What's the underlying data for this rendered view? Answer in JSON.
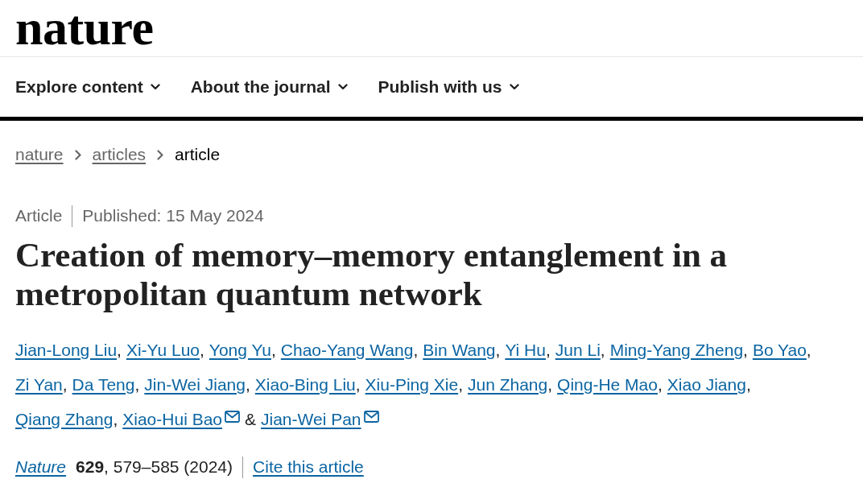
{
  "header": {
    "logo": "nature"
  },
  "nav": [
    {
      "label": "Explore content"
    },
    {
      "label": "About the journal"
    },
    {
      "label": "Publish with us"
    }
  ],
  "breadcrumb": [
    {
      "label": "nature",
      "current": false
    },
    {
      "label": "articles",
      "current": false
    },
    {
      "label": "article",
      "current": true
    }
  ],
  "article": {
    "type": "Article",
    "published": "Published: 15 May 2024",
    "title": "Creation of memory–memory entanglement in a metropolitan quantum network",
    "authors": [
      {
        "name": "Jian-Long Liu",
        "separator": ",",
        "contact": false
      },
      {
        "name": "Xi-Yu Luo",
        "separator": ",",
        "contact": false
      },
      {
        "name": "Yong Yu",
        "separator": ",",
        "contact": false
      },
      {
        "name": "Chao-Yang Wang",
        "separator": ",",
        "contact": false
      },
      {
        "name": "Bin Wang",
        "separator": ",",
        "contact": false
      },
      {
        "name": "Yi Hu",
        "separator": ",",
        "contact": false
      },
      {
        "name": "Jun Li",
        "separator": ",",
        "contact": false
      },
      {
        "name": "Ming-Yang Zheng",
        "separator": ",",
        "contact": false
      },
      {
        "name": "Bo Yao",
        "separator": ",",
        "contact": false
      },
      {
        "name": "Zi Yan",
        "separator": ",",
        "contact": false
      },
      {
        "name": "Da Teng",
        "separator": ",",
        "contact": false
      },
      {
        "name": "Jin-Wei Jiang",
        "separator": ",",
        "contact": false
      },
      {
        "name": "Xiao-Bing Liu",
        "separator": ",",
        "contact": false
      },
      {
        "name": "Xiu-Ping Xie",
        "separator": ",",
        "contact": false
      },
      {
        "name": "Jun Zhang",
        "separator": ",",
        "contact": false
      },
      {
        "name": "Qing-He Mao",
        "separator": ",",
        "contact": false
      },
      {
        "name": "Xiao Jiang",
        "separator": ",",
        "contact": false
      },
      {
        "name": "Qiang Zhang",
        "separator": ",",
        "contact": false
      },
      {
        "name": "Xiao-Hui Bao",
        "separator": "&",
        "contact": true
      },
      {
        "name": "Jian-Wei Pan",
        "contact": true
      }
    ],
    "citation": {
      "journal": "Nature",
      "details": "**629**, 579–585 (2024)",
      "cite_link": "Cite this article"
    }
  }
}
